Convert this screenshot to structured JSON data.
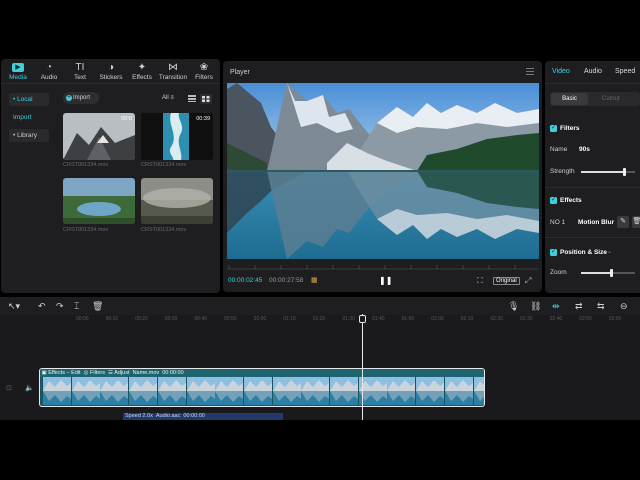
{
  "colors": {
    "accent": "#3fd0dc",
    "panel": "#1e1e20",
    "background": "#000000"
  },
  "media_tabs": [
    {
      "label": "Media",
      "icon": "media-icon",
      "active": true
    },
    {
      "label": "Audio",
      "icon": "audio-icon"
    },
    {
      "label": "Text",
      "icon": "text-icon"
    },
    {
      "label": "Stickers",
      "icon": "stickers-icon"
    },
    {
      "label": "Effects",
      "icon": "effects-icon"
    },
    {
      "label": "Transition",
      "icon": "transition-icon"
    },
    {
      "label": "Filters",
      "icon": "filters-icon"
    }
  ],
  "sidebar": {
    "items": [
      {
        "label": "• Local",
        "active": true
      },
      {
        "label": "Import"
      },
      {
        "label": "• Library"
      }
    ]
  },
  "media": {
    "import_label": "Import",
    "filter_label": "All",
    "items": [
      {
        "name": "CRST001334.mov",
        "duration": "00:0"
      },
      {
        "name": "CRST001334.mov",
        "duration": "00:39"
      },
      {
        "name": "CRST001334.mov",
        "duration": ""
      },
      {
        "name": "CRST001334.mov",
        "duration": ""
      }
    ]
  },
  "player": {
    "title": "Player",
    "current_time": "00:00:02:45",
    "total_time": "00:00:27:58",
    "ratio_label": "Original"
  },
  "inspector": {
    "tabs": [
      "Video",
      "Audio",
      "Speed"
    ],
    "segments": [
      "Basic",
      "Cutout"
    ],
    "filters_label": "Filters",
    "name_label": "Name",
    "name_value": "90s",
    "strength_label": "Strength",
    "strength_value": 0.8,
    "effects_label": "Effects",
    "effect_no": "NO 1",
    "effect_name": "Motion Blur",
    "position_label": "Position & Size",
    "zoom_label": "Zoom",
    "zoom_value": 0.55
  },
  "timeline": {
    "ticks": [
      "00:00",
      "00:10",
      "00:20",
      "00:30",
      "00:40",
      "00:50",
      "01:00",
      "01:10",
      "01:20",
      "01:30",
      "01:40",
      "01:50",
      "02:00",
      "02:10",
      "02:20",
      "02:30",
      "02:40",
      "02:50",
      "03:00"
    ],
    "clip": {
      "effects": "Effects – Edit",
      "filters": "Filters",
      "adjust": "Adjust",
      "name": "Name.mov",
      "time": "00:00:00"
    },
    "audio": {
      "speed": "Speed 2.0x",
      "name": "Audio.aac",
      "time": "00:00:00"
    }
  }
}
